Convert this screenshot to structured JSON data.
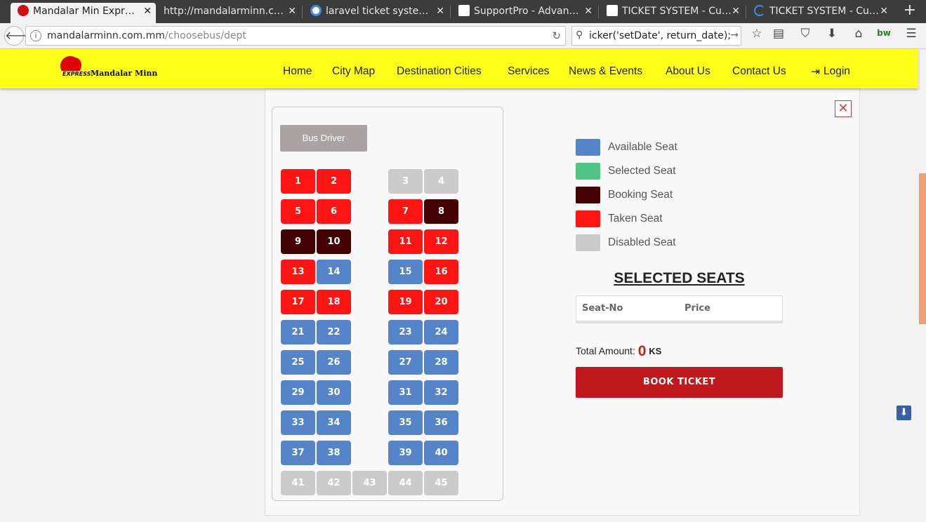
{
  "browser": {
    "tabs": [
      {
        "title": "Mandalar Min Expr…",
        "favicon_color": "#d01010",
        "active": true
      },
      {
        "title": "http://mandalarminn.c…",
        "favicon_color": "",
        "active": false
      },
      {
        "title": "laravel ticket syste…",
        "favicon_color": "#4285f4",
        "active": false
      },
      {
        "title": "SupportPro - Advan…",
        "favicon_color": "#ffffff",
        "active": false
      },
      {
        "title": "TICKET SYSTEM - Cu…",
        "favicon_color": "#ffffff",
        "active": false
      },
      {
        "title": "TICKET SYSTEM - Cu…",
        "favicon_color": "#3a8ee6",
        "active": false
      }
    ],
    "new_tab": "+",
    "url_domain": "mandalarminn.com.mm",
    "url_path": "/choosebus/dept",
    "search_value": "icker('setDate', return_date);"
  },
  "site": {
    "logo_express": "EXPRESS",
    "logo_name": "Mandalar Minn",
    "menu": [
      "Home",
      "City Map",
      "Destination Cities",
      "Services",
      "News & Events",
      "About Us",
      "Contact Us",
      "Login"
    ]
  },
  "bus": {
    "driver_label": "Bus Driver",
    "status_colors": {
      "available": "#5585c8",
      "selected": "#50c484",
      "booking": "#420000",
      "taken": "#ff1414",
      "disabled": "#cbcbcb"
    },
    "seats": [
      {
        "no": "1",
        "status": "taken"
      },
      {
        "no": "2",
        "status": "taken"
      },
      {
        "no": "3",
        "status": "disabled"
      },
      {
        "no": "4",
        "status": "disabled"
      },
      {
        "no": "5",
        "status": "taken"
      },
      {
        "no": "6",
        "status": "taken"
      },
      {
        "no": "7",
        "status": "taken"
      },
      {
        "no": "8",
        "status": "booking"
      },
      {
        "no": "9",
        "status": "booking"
      },
      {
        "no": "10",
        "status": "booking"
      },
      {
        "no": "11",
        "status": "taken"
      },
      {
        "no": "12",
        "status": "taken"
      },
      {
        "no": "13",
        "status": "taken"
      },
      {
        "no": "14",
        "status": "available"
      },
      {
        "no": "15",
        "status": "available"
      },
      {
        "no": "16",
        "status": "taken"
      },
      {
        "no": "17",
        "status": "taken"
      },
      {
        "no": "18",
        "status": "taken"
      },
      {
        "no": "19",
        "status": "taken"
      },
      {
        "no": "20",
        "status": "taken"
      },
      {
        "no": "21",
        "status": "available"
      },
      {
        "no": "22",
        "status": "available"
      },
      {
        "no": "23",
        "status": "available"
      },
      {
        "no": "24",
        "status": "available"
      },
      {
        "no": "25",
        "status": "available"
      },
      {
        "no": "26",
        "status": "available"
      },
      {
        "no": "27",
        "status": "available"
      },
      {
        "no": "28",
        "status": "available"
      },
      {
        "no": "29",
        "status": "available"
      },
      {
        "no": "30",
        "status": "available"
      },
      {
        "no": "31",
        "status": "available"
      },
      {
        "no": "32",
        "status": "available"
      },
      {
        "no": "33",
        "status": "available"
      },
      {
        "no": "34",
        "status": "available"
      },
      {
        "no": "35",
        "status": "available"
      },
      {
        "no": "36",
        "status": "available"
      },
      {
        "no": "37",
        "status": "available"
      },
      {
        "no": "38",
        "status": "available"
      },
      {
        "no": "39",
        "status": "available"
      },
      {
        "no": "40",
        "status": "available"
      },
      {
        "no": "41",
        "status": "disabled"
      },
      {
        "no": "42",
        "status": "disabled"
      },
      {
        "no": "43",
        "status": "disabled"
      },
      {
        "no": "44",
        "status": "disabled"
      },
      {
        "no": "45",
        "status": "disabled"
      }
    ]
  },
  "legend": [
    {
      "label": "Available Seat",
      "status": "available"
    },
    {
      "label": "Selected Seat",
      "status": "selected"
    },
    {
      "label": "Booking Seat",
      "status": "booking"
    },
    {
      "label": "Taken Seat",
      "status": "taken"
    },
    {
      "label": "Disabled Seat",
      "status": "disabled"
    }
  ],
  "summary": {
    "title": "SELECTED SEATS",
    "col_seat": "Seat-No",
    "col_price": "Price",
    "total_label": "Total Amount:",
    "total_value": "0",
    "currency": "KS",
    "book_label": "BOOK TICKET"
  }
}
